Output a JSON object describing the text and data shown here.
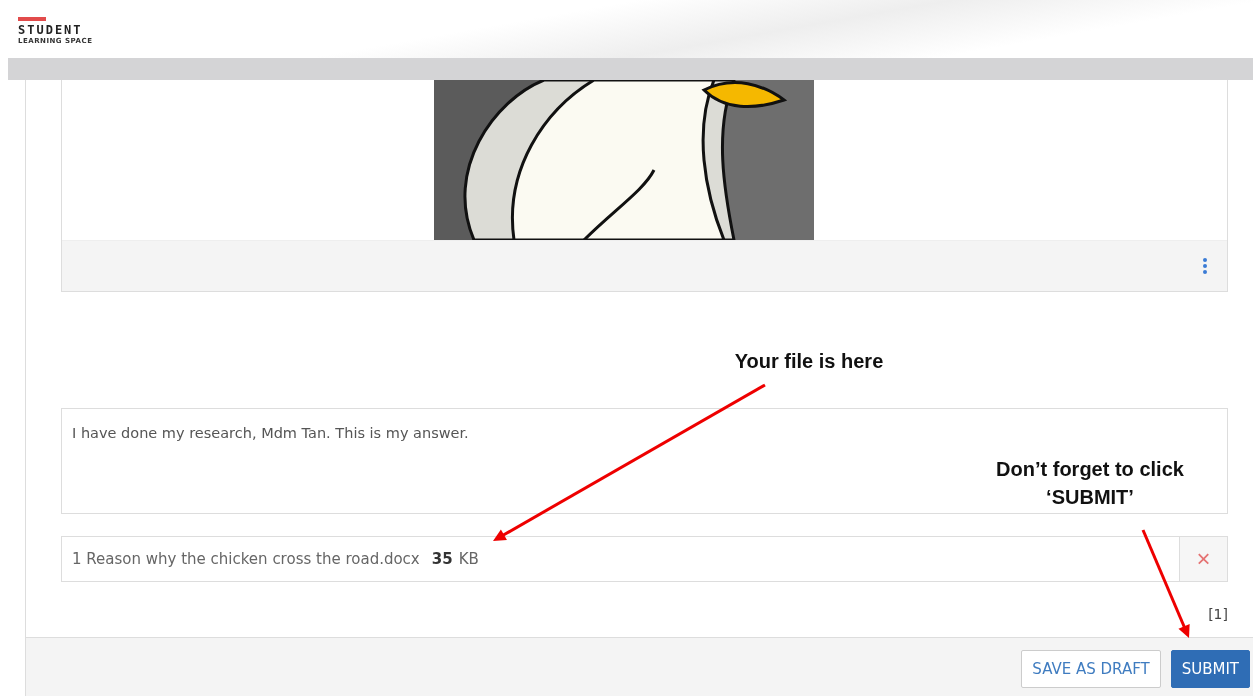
{
  "logo": {
    "title": "STUDENT",
    "subtitle": "LEARNING SPACE"
  },
  "annotations": [
    {
      "text": "Your file is here"
    },
    {
      "text": "Don’t forget to click ‘SUBMIT’"
    }
  ],
  "answer": {
    "value": "I have done my research, Mdm Tan. This is my answer."
  },
  "attachment": {
    "name": "1 Reason why the chicken cross the road.docx",
    "size": "35",
    "unit": "KB",
    "remove": "×"
  },
  "attachment_count": "[1]",
  "buttons": [
    {
      "label": "SAVE AS DRAFT",
      "kind": "secondary"
    },
    {
      "label": "SUBMIT",
      "kind": "primary"
    }
  ]
}
